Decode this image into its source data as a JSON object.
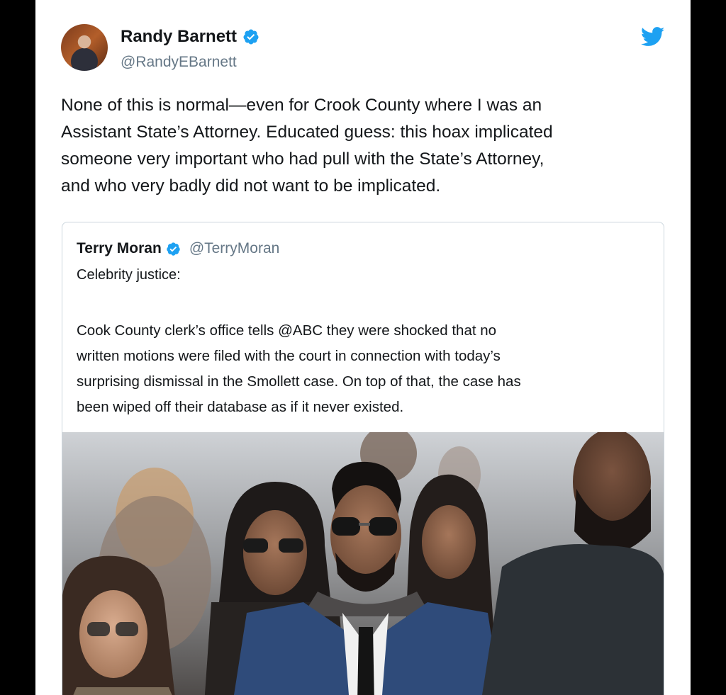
{
  "tweet": {
    "author_name": "Randy Barnett",
    "author_handle": "@RandyEBarnett",
    "text_lines": [
      "None of this is normal—even for Crook County where I was an",
      "Assistant State’s Attorney. Educated guess: this hoax implicated",
      "someone very important who had pull with the State’s Attorney,",
      "and who very badly did not want to be implicated."
    ]
  },
  "quoted_tweet": {
    "author_name": "Terry Moran",
    "author_handle": "@TerryMoran",
    "first_line": "Celebrity justice:",
    "body_lines": [
      "Cook County clerk’s office tells @ABC they were shocked that no",
      "written motions were filed with the court in connection with today’s",
      "surprising dismissal in the Smollett case. On top of that, the case has",
      "been wiped off their database as if it never existed."
    ]
  },
  "icons": {
    "verified": "verified-badge-icon",
    "brand": "twitter-bird-icon"
  },
  "colors": {
    "twitter_blue": "#1da1f2",
    "text_primary": "#14171a",
    "text_secondary": "#657786",
    "border": "#ccd6dd"
  }
}
